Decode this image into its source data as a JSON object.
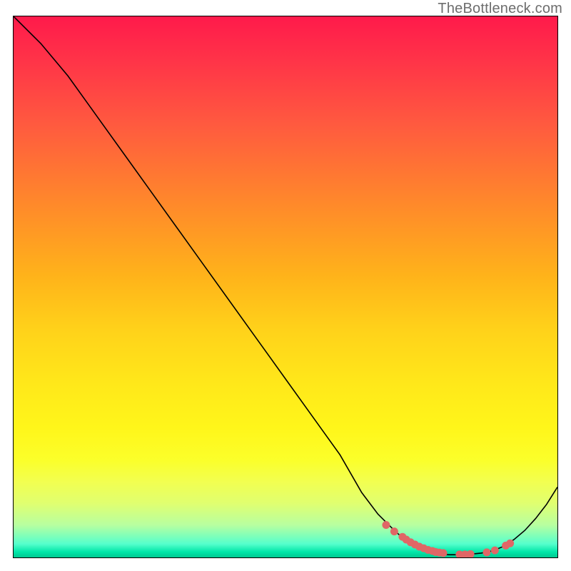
{
  "watermark": "TheBottleneck.com",
  "chart_data": {
    "type": "line",
    "title": "",
    "xlabel": "",
    "ylabel": "",
    "xlim": [
      0,
      100
    ],
    "ylim": [
      0,
      100
    ],
    "grid": false,
    "legend": false,
    "series": [
      {
        "name": "bottleneck-curve",
        "x": [
          0,
          5,
          10,
          15,
          20,
          25,
          30,
          35,
          40,
          45,
          50,
          55,
          60,
          64,
          67,
          70,
          72,
          74,
          76,
          78,
          80,
          82,
          84,
          86,
          88,
          90,
          92,
          94,
          96,
          98,
          100
        ],
        "y": [
          100,
          95,
          89,
          82,
          75,
          68,
          61,
          54,
          47,
          40,
          33,
          26,
          19,
          12,
          8,
          5,
          3.2,
          2.0,
          1.2,
          0.7,
          0.5,
          0.5,
          0.6,
          0.8,
          1.2,
          2.0,
          3.3,
          5.0,
          7.2,
          9.8,
          13
        ]
      }
    ],
    "markers": {
      "name": "highlight-dots",
      "x": [
        68.5,
        70.0,
        71.5,
        72.2,
        73.0,
        73.8,
        74.6,
        75.4,
        76.2,
        77.0,
        77.6,
        78.3,
        79.0,
        82.0,
        83.0,
        84.0,
        87.0,
        88.5,
        90.5,
        91.3
      ],
      "y": [
        6.0,
        4.8,
        3.8,
        3.3,
        2.8,
        2.4,
        2.0,
        1.7,
        1.4,
        1.2,
        1.0,
        0.9,
        0.8,
        0.55,
        0.55,
        0.6,
        0.95,
        1.3,
        2.2,
        2.6
      ]
    }
  }
}
